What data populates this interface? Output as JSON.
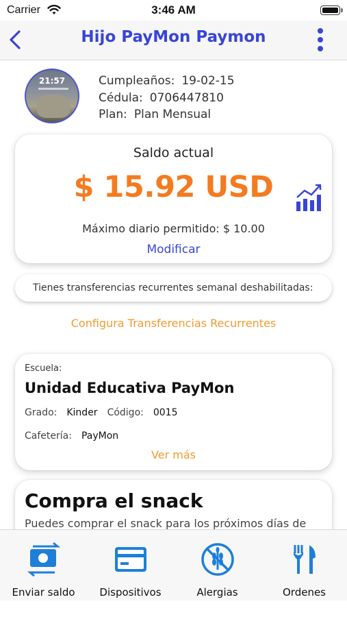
{
  "status_bar": {
    "carrier": "Carrier",
    "time": "3:46 AM"
  },
  "nav": {
    "title": "Hijo PayMon Paymon",
    "back_icon": "chevron-left-icon",
    "more_icon": "vertical-dots-icon"
  },
  "profile": {
    "avatar_clock": "21:57",
    "birthday_label": "Cumpleaños:",
    "birthday_value": "19-02-15",
    "id_label": "Cédula:",
    "id_value": "0706447810",
    "plan_label": "Plan:",
    "plan_value": "Plan Mensual"
  },
  "balance": {
    "label": "Saldo actual",
    "amount": "$ 15.92 USD",
    "max_daily": "Máximo diario permitido: $ 10.00",
    "modify": "Modificar",
    "chart_icon": "bar-chart-trend-icon"
  },
  "recurrent": {
    "status_text": "Tienes transferencias recurrentes semanal deshabilitadas:",
    "configure_link": "Configura Transferencias Recurrentes"
  },
  "school": {
    "school_label": "Escuela:",
    "school_name": "Unidad Educativa PayMon",
    "grade_label": "Grado:",
    "grade_value": "Kinder",
    "code_label": "Código:",
    "code_value": "0015",
    "cafeteria_label": "Cafetería:",
    "cafeteria_value": "PayMon",
    "see_more": "Ver más"
  },
  "snack": {
    "title": "Compra el snack",
    "description": "Puedes comprar el snack para los próximos días de"
  },
  "tabs": [
    {
      "label": "Enviar saldo",
      "icon": "money-transfer-icon"
    },
    {
      "label": "Dispositivos",
      "icon": "credit-card-icon"
    },
    {
      "label": "Alergias",
      "icon": "no-wheat-icon"
    },
    {
      "label": "Ordenes",
      "icon": "fork-knife-icon"
    }
  ],
  "colors": {
    "primary": "#3845d6",
    "orange": "#f47b20",
    "link_orange": "#f39a2e",
    "tab_icon": "#1e7fd9"
  }
}
